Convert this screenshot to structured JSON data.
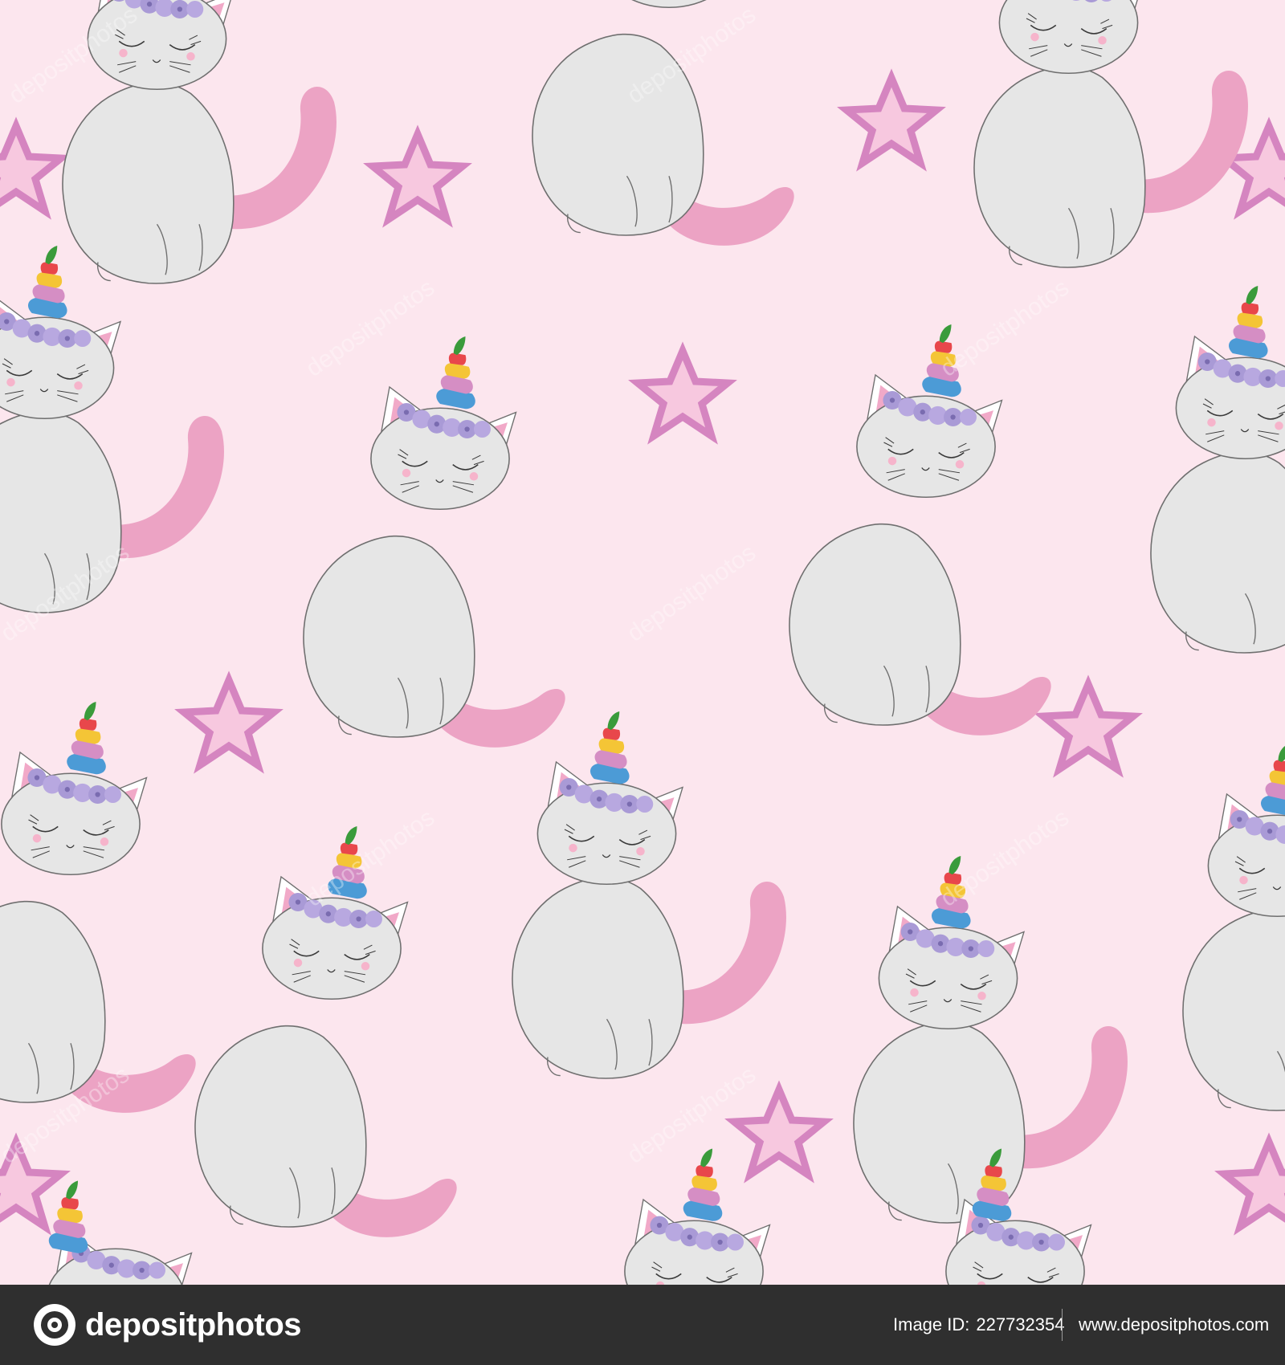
{
  "colors": {
    "background": "#fce6ee",
    "cat_body": "#e6e6e6",
    "cat_outline": "#6f6f6f",
    "tail": "#eca3c4",
    "ear_inner": "#f1a9c8",
    "star_outer": "#d585c0",
    "star_inner": "#f7c8df",
    "flowers": "#a99ad6",
    "horn": [
      "#3a9b3b",
      "#e8474b",
      "#f4c536",
      "#d58ec4",
      "#4c9bd6"
    ],
    "footer_bg": "#2f2f2f"
  },
  "watermark": {
    "text": "depositphotos"
  },
  "footer": {
    "logo_text": "depositphotos",
    "image_id_label": "Image ID:",
    "image_id_value": "227732354",
    "site_url": "www.depositphotos.com"
  }
}
